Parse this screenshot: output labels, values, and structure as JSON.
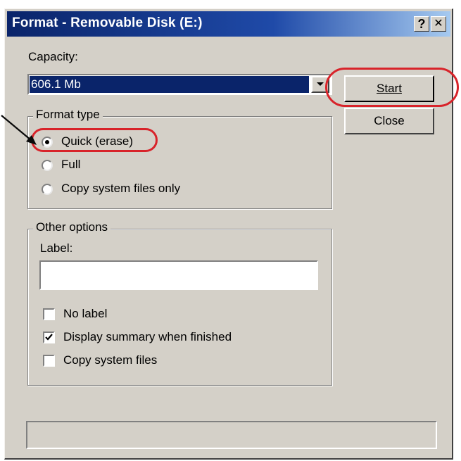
{
  "window": {
    "title": "Format - Removable Disk (E:)",
    "help_glyph": "?",
    "close_glyph": "✕"
  },
  "capacity": {
    "label": "Capacity:",
    "selected_value": "606.1 Mb",
    "dropdown_icon": "chevron-down-icon"
  },
  "buttons": {
    "start": "Start",
    "close": "Close"
  },
  "format_type": {
    "legend": "Format type",
    "options": [
      {
        "label": "Quick (erase)",
        "selected": true
      },
      {
        "label": "Full",
        "selected": false
      },
      {
        "label": "Copy system files only",
        "selected": false
      }
    ]
  },
  "other_options": {
    "legend": "Other options",
    "label_field_label": "Label:",
    "label_field_value": "",
    "checkboxes": [
      {
        "label": "No label",
        "checked": false
      },
      {
        "label": "Display summary when finished",
        "checked": true
      },
      {
        "label": "Copy system files",
        "checked": false
      }
    ]
  },
  "status_bar": {
    "text": ""
  },
  "annotations": {
    "color": "#d8232a",
    "highlighted": [
      "start-button",
      "radio-quick-erase"
    ]
  }
}
